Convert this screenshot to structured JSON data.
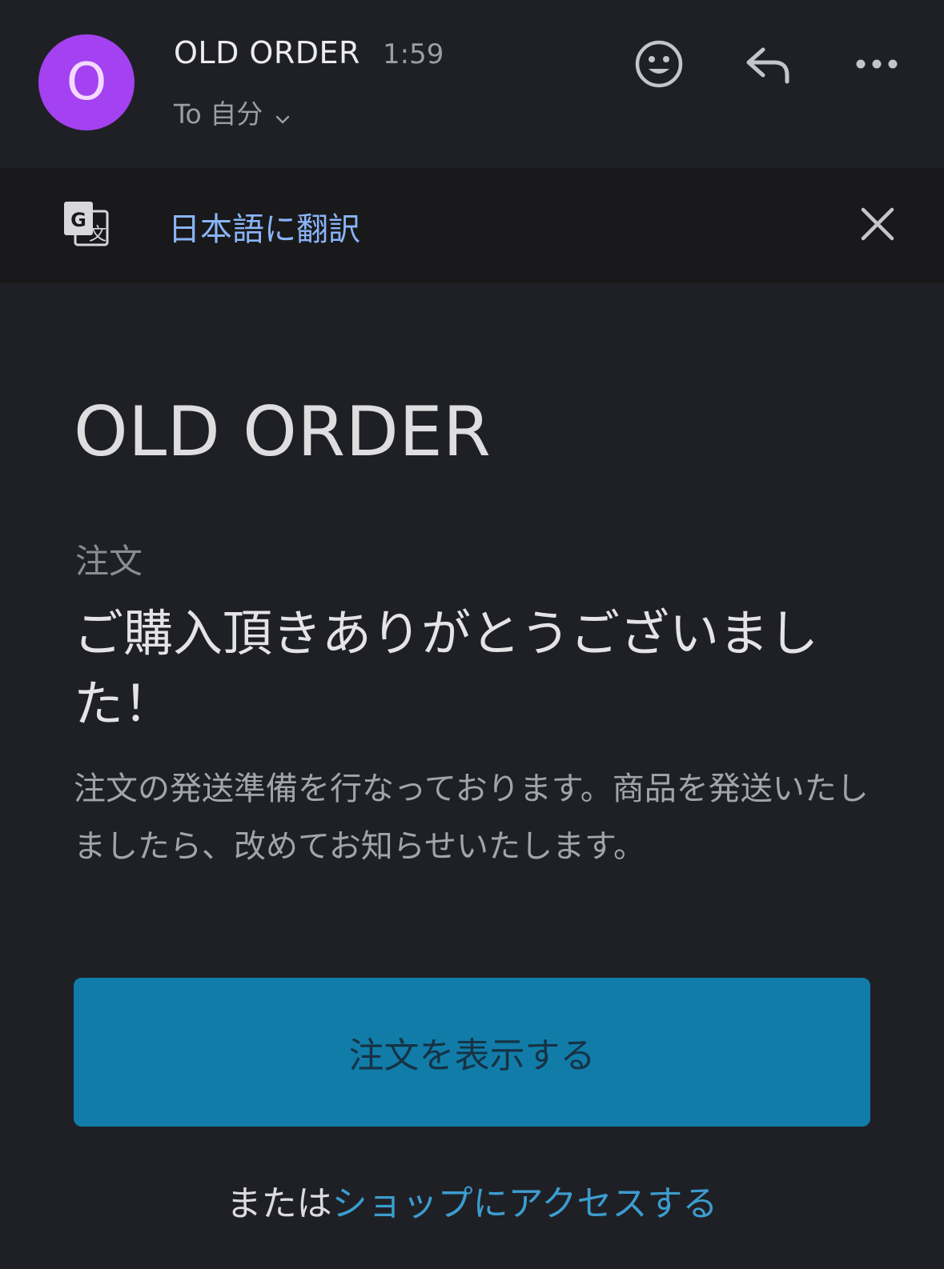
{
  "header": {
    "avatar_letter": "O",
    "sender": "OLD ORDER",
    "time": "1:59",
    "recipient": "To 自分",
    "icons": [
      "emoji-icon",
      "reply-icon",
      "more-icon"
    ]
  },
  "translate_bar": {
    "icon": "google-translate-icon",
    "link_label": "日本語に翻訳",
    "close_icon": "close-icon"
  },
  "email": {
    "title": "OLD ORDER",
    "section_label": "注文",
    "headline": "ご購入頂きありがとうございました！",
    "message": "注文の発送準備を行なっております。商品を発送いたしましたら、改めてお知らせいたします。",
    "button_label": "注文を表示する",
    "alt_prefix": "または",
    "alt_link": "ショップにアクセスする"
  },
  "colors": {
    "background": "#1f2025",
    "translate_bar": "#19191b",
    "avatar": "#a441f0",
    "link": "#8ab4f8",
    "button": "#117ca8",
    "shop_link": "#3c9dd0"
  }
}
